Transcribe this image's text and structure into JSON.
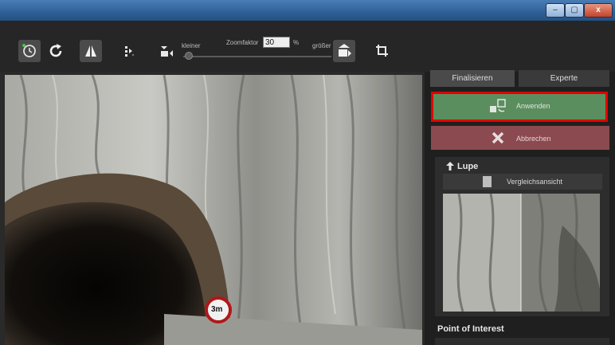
{
  "window": {
    "buttons": [
      "–",
      "▢",
      "x"
    ]
  },
  "toolbar": {
    "zoom_label": "Zoomfaktor",
    "zoom_value": "30",
    "zoom_unit": "%",
    "smaller_label": "kleiner",
    "larger_label": "größer",
    "icons": [
      "history-icon",
      "redo-icon",
      "compare-icon",
      "move-icon",
      "zoom-out-icon",
      "zoom-in-icon",
      "crop-rotate-icon"
    ]
  },
  "canvas": {
    "sign_text": "3m"
  },
  "panel": {
    "tabs": [
      "Finalisieren",
      "Experte"
    ],
    "apply_label": "Anwenden",
    "cancel_label": "Abbrechen",
    "lupe_title": "Lupe",
    "compare_label": "Vergleichsansicht",
    "poi_title": "Point of Interest"
  },
  "colors": {
    "apply_green": "#5b8e5e",
    "cancel_red": "#8b4a4f",
    "highlight": "#e10000"
  }
}
